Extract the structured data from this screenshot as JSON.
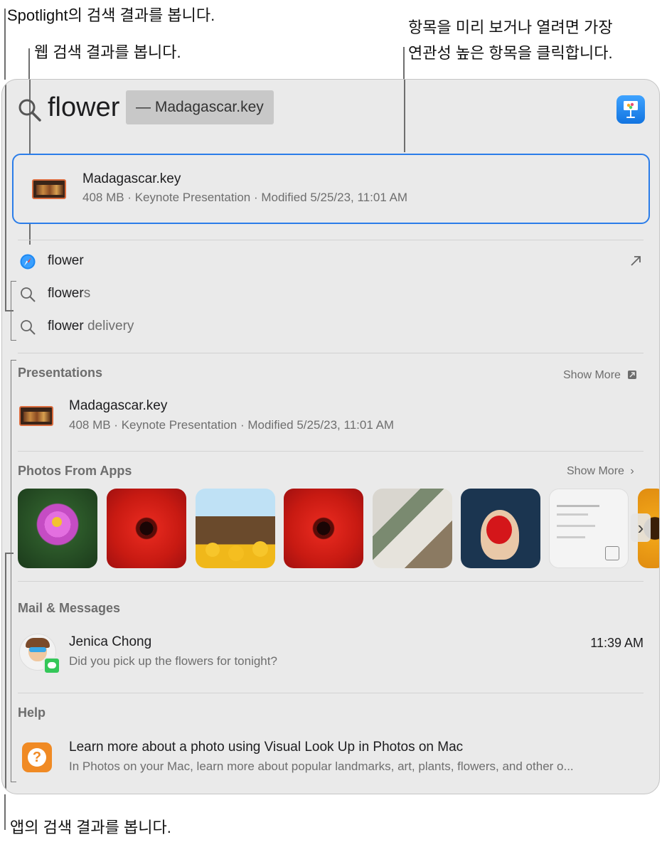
{
  "callouts": {
    "spotlight": "Spotlight의 검색 결과를 봅니다.",
    "web": "웹 검색 결과를 봅니다.",
    "preview_line1": "항목을 미리 보거나 열려면 가장",
    "preview_line2": "연관성 높은 항목을 클릭합니다.",
    "apps": "앱의 검색 결과를 봅니다."
  },
  "search": {
    "query": "flower",
    "completion": "— Madagascar.key"
  },
  "top_hit": {
    "title": "Madagascar.key",
    "subtitle": "408 MB · Keynote Presentation · Modified 5/25/23, 11:01 AM"
  },
  "suggestions": [
    {
      "icon": "safari-icon",
      "typed": "flower",
      "rest": ""
    },
    {
      "icon": "search-icon",
      "typed": "flower",
      "rest": "s"
    },
    {
      "icon": "search-icon",
      "typed": "flower",
      "rest": " delivery"
    }
  ],
  "presentations": {
    "header": "Presentations",
    "show_more": "Show More",
    "item_title": "Madagascar.key",
    "item_subtitle": "408 MB · Keynote Presentation · Modified 5/25/23, 11:01 AM"
  },
  "photos": {
    "header": "Photos From Apps",
    "show_more": "Show More",
    "items": [
      "pink cosmos flower",
      "red gerbera",
      "friends with sunflowers",
      "red gerbera",
      "interior collage",
      "person holding red flower",
      "document screenshot",
      "sunflowers"
    ]
  },
  "mail": {
    "header": "Mail & Messages",
    "sender": "Jenica Chong",
    "time": "11:39 AM",
    "preview": "Did you pick up the flowers for tonight?"
  },
  "help": {
    "header": "Help",
    "title": "Learn more about a photo using Visual Look Up in Photos on Mac",
    "subtitle": "In Photos on your Mac, learn more about popular landmarks, art, plants, flowers, and other o..."
  },
  "colors": {
    "accent": "#2b7de9",
    "panel": "#eaeaea",
    "keynote": "#1d8cf8",
    "help": "#f08a24"
  }
}
